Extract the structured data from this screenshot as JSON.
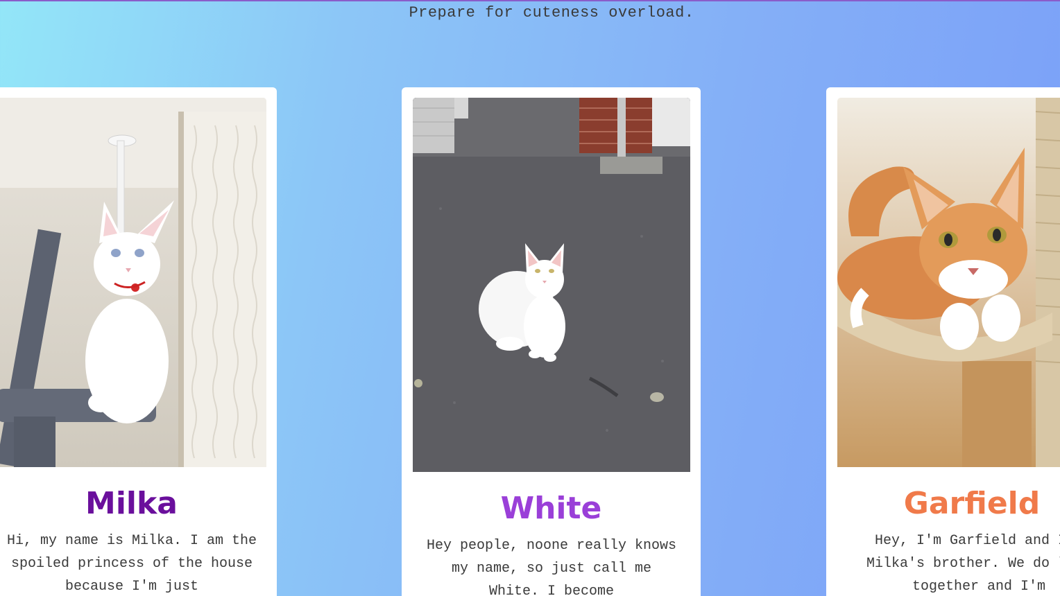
{
  "page": {
    "tagline": "Prepare for cuteness overload."
  },
  "cards": [
    {
      "name": "Milka",
      "bio": "Hi, my name is Milka. I am the spoiled princess of the house because I'm just",
      "name_color": "#6a0f9c"
    },
    {
      "name": "White",
      "bio": "Hey people, noone really knows my name, so just call me White. I become",
      "name_color": "#9a3fd8"
    },
    {
      "name": "Garfield",
      "bio": "Hey, I'm Garfield and I'm Milka's brother. We do live together and I'm",
      "name_color": "#f07a4a"
    }
  ],
  "colors": {
    "gradient_start": "#93e6f8",
    "gradient_end": "#7a9ff8",
    "card_background": "#ffffff",
    "top_border": "#8a5cc9"
  }
}
